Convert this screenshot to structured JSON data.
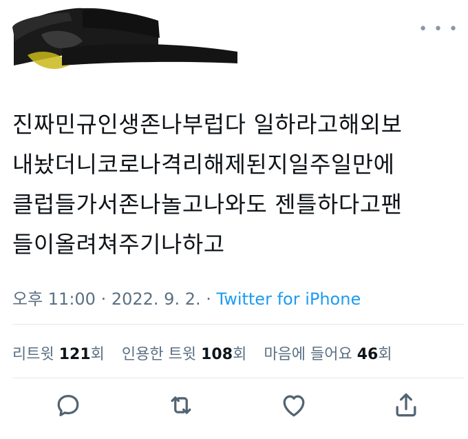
{
  "tweet": {
    "lines": [
      "진짜민규인생존나부럽다 일하라고해외보",
      "내놨더니코로나격리해제된지일주일만에",
      "클럽들가서존나놀고나와도 젠틀하다고팬",
      "들이올려쳐주기나하고"
    ]
  },
  "meta": {
    "time": "오후 11:00",
    "sep": " · ",
    "date": "2022. 9. 2.",
    "source": "Twitter for iPhone"
  },
  "stats": {
    "retweets_label": "리트윗",
    "retweets_count": "121",
    "retweets_unit": "회",
    "quotes_label": "인용한 트윗",
    "quotes_count": "108",
    "quotes_unit": "회",
    "likes_label": "마음에 들어요",
    "likes_count": "46",
    "likes_unit": "회"
  },
  "icons": {
    "more": "more-icon",
    "reply": "reply-icon",
    "retweet": "retweet-icon",
    "like": "heart-icon",
    "share": "share-icon"
  },
  "colors": {
    "text": "#0f1419",
    "secondary": "#5b7083",
    "accent": "#1d9bf0",
    "divider": "#e1e8ed"
  }
}
